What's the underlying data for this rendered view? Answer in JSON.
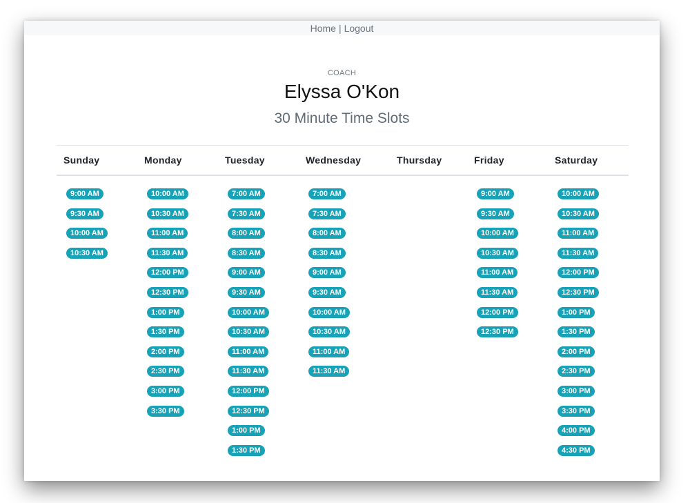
{
  "nav": {
    "home_label": "Home",
    "separator": "|",
    "logout_label": "Logout"
  },
  "header": {
    "role": "COACH",
    "name": "Elyssa O'Kon",
    "subtitle": "30 Minute Time Slots"
  },
  "colors": {
    "slot_badge": "#17a2b8",
    "slot_text": "#ffffff",
    "divider": "#dee2e6"
  },
  "schedule": {
    "days": [
      {
        "name": "Sunday",
        "slots": [
          "9:00 AM",
          "9:30 AM",
          "10:00 AM",
          "10:30 AM"
        ]
      },
      {
        "name": "Monday",
        "slots": [
          "10:00 AM",
          "10:30 AM",
          "11:00 AM",
          "11:30 AM",
          "12:00 PM",
          "12:30 PM",
          "1:00 PM",
          "1:30 PM",
          "2:00 PM",
          "2:30 PM",
          "3:00 PM",
          "3:30 PM"
        ]
      },
      {
        "name": "Tuesday",
        "slots": [
          "7:00 AM",
          "7:30 AM",
          "8:00 AM",
          "8:30 AM",
          "9:00 AM",
          "9:30 AM",
          "10:00 AM",
          "10:30 AM",
          "11:00 AM",
          "11:30 AM",
          "12:00 PM",
          "12:30 PM",
          "1:00 PM",
          "1:30 PM"
        ]
      },
      {
        "name": "Wednesday",
        "slots": [
          "7:00 AM",
          "7:30 AM",
          "8:00 AM",
          "8:30 AM",
          "9:00 AM",
          "9:30 AM",
          "10:00 AM",
          "10:30 AM",
          "11:00 AM",
          "11:30 AM"
        ]
      },
      {
        "name": "Thursday",
        "slots": []
      },
      {
        "name": "Friday",
        "slots": [
          "9:00 AM",
          "9:30 AM",
          "10:00 AM",
          "10:30 AM",
          "11:00 AM",
          "11:30 AM",
          "12:00 PM",
          "12:30 PM"
        ]
      },
      {
        "name": "Saturday",
        "slots": [
          "10:00 AM",
          "10:30 AM",
          "11:00 AM",
          "11:30 AM",
          "12:00 PM",
          "12:30 PM",
          "1:00 PM",
          "1:30 PM",
          "2:00 PM",
          "2:30 PM",
          "3:00 PM",
          "3:30 PM",
          "4:00 PM",
          "4:30 PM"
        ]
      }
    ]
  }
}
